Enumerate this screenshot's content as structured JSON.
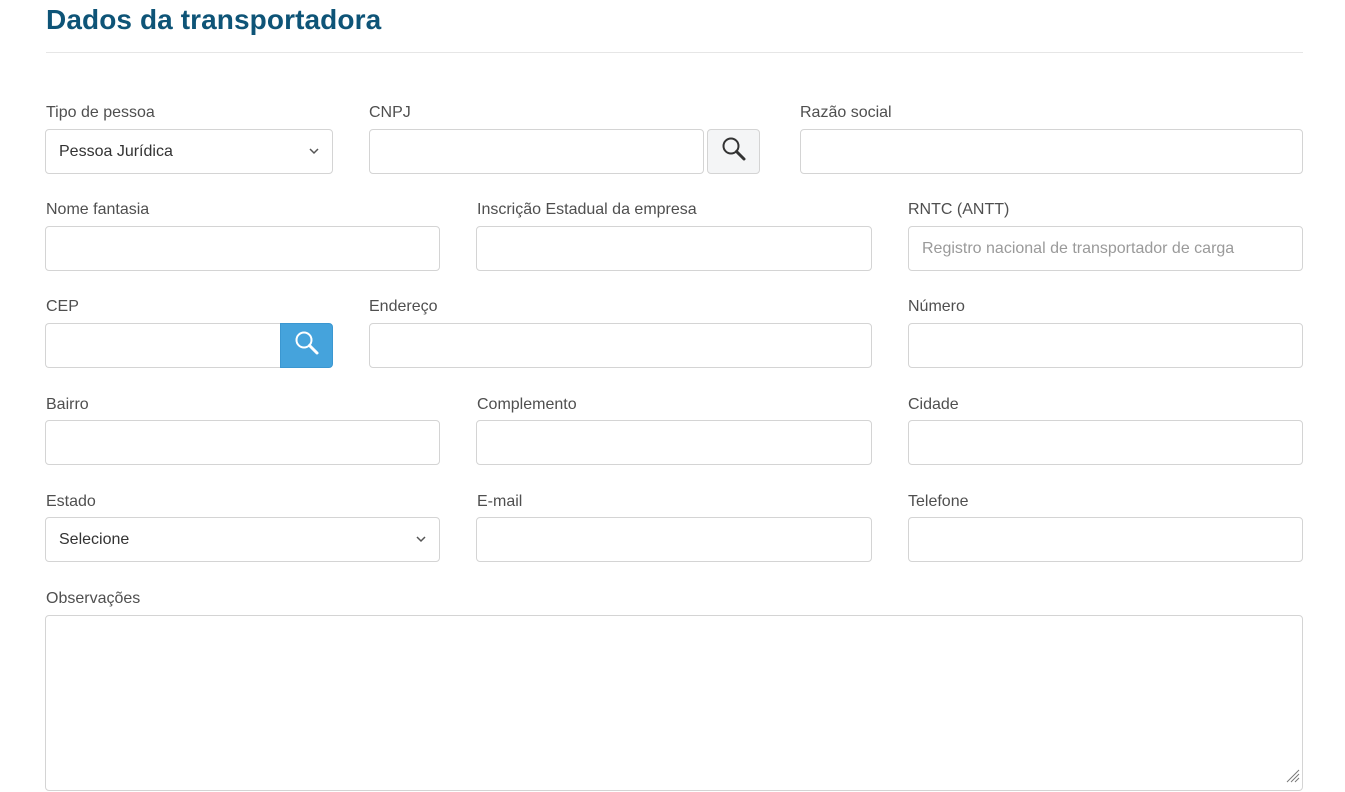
{
  "section": {
    "title": "Dados da transportadora"
  },
  "fields": {
    "tipo_pessoa": {
      "label": "Tipo de pessoa",
      "value": "Pessoa Jurídica"
    },
    "cnpj": {
      "label": "CNPJ",
      "value": ""
    },
    "razao_social": {
      "label": "Razão social",
      "value": ""
    },
    "nome_fantasia": {
      "label": "Nome fantasia",
      "value": ""
    },
    "inscricao_estadual": {
      "label": "Inscrição Estadual da empresa",
      "value": ""
    },
    "rntc": {
      "label": "RNTC (ANTT)",
      "value": "",
      "placeholder": "Registro nacional de transportador de carga"
    },
    "cep": {
      "label": "CEP",
      "value": ""
    },
    "endereco": {
      "label": "Endereço",
      "value": ""
    },
    "numero": {
      "label": "Número",
      "value": ""
    },
    "bairro": {
      "label": "Bairro",
      "value": ""
    },
    "complemento": {
      "label": "Complemento",
      "value": ""
    },
    "cidade": {
      "label": "Cidade",
      "value": ""
    },
    "estado": {
      "label": "Estado",
      "value": "Selecione"
    },
    "email": {
      "label": "E-mail",
      "value": ""
    },
    "telefone": {
      "label": "Telefone",
      "value": ""
    },
    "observacoes": {
      "label": "Observações",
      "value": ""
    }
  },
  "icons": {
    "cnpj_search": "search-icon",
    "cep_search": "search-icon",
    "select_arrow": "chevron-down-icon",
    "resize": "resize-grip-icon"
  },
  "colors": {
    "title": "#0e5477",
    "primary_button": "#45a3dc"
  }
}
